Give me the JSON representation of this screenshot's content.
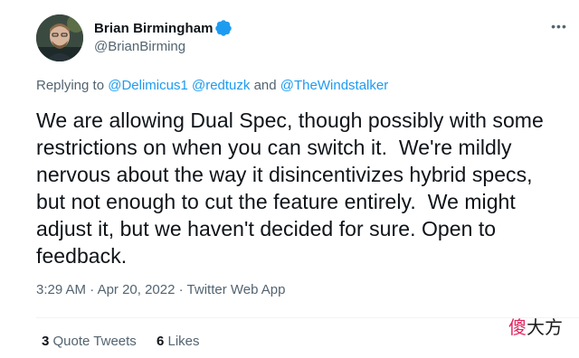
{
  "author": {
    "display_name": "Brian Birmingham",
    "handle": "@BrianBirming",
    "verified": true
  },
  "reply_context": {
    "prefix": "Replying to",
    "mentions": [
      "@Delimicus1",
      "@redtuzk",
      "@TheWindstalker"
    ],
    "joiner_comma": " ",
    "joiner_and": " and "
  },
  "tweet": {
    "text": "We are allowing Dual Spec, though possibly with some\nrestrictions on when you can switch it.  We're mildly\nnervous about the way it disincentivizes hybrid specs,\nbut not enough to cut the feature entirely.  We might\nadjust it, but we haven't decided for sure. Open to\nfeedback."
  },
  "meta": {
    "time": "3:29 AM",
    "separator": " · ",
    "date": "Apr 20, 2022",
    "source": "Twitter Web App"
  },
  "stats": {
    "quote_tweets_count": "3",
    "quote_tweets_label": "Quote Tweets",
    "likes_count": "6",
    "likes_label": "Likes"
  },
  "watermark": {
    "part1": "傻",
    "part2": "大方"
  },
  "colors": {
    "link_blue": "#1d9bf0",
    "secondary_text": "#536471",
    "primary_text": "#0f1419",
    "divider": "#eff3f4"
  },
  "icons": {
    "verified": "verified-badge-icon",
    "more": "more-options-icon"
  }
}
